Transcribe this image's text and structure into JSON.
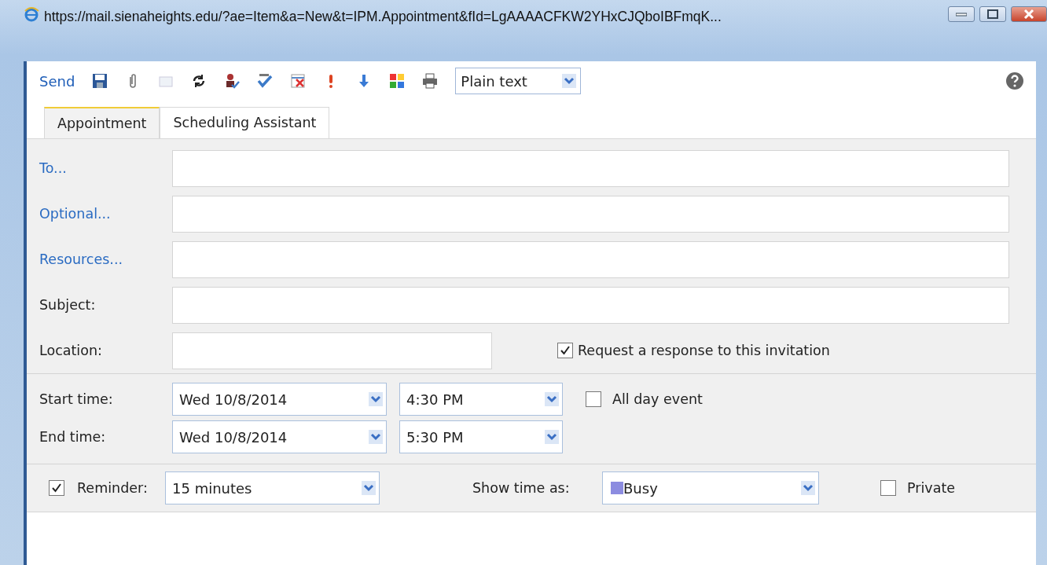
{
  "window": {
    "title": "https://mail.sienaheights.edu/?ae=Item&a=New&t=IPM.Appointment&fId=LgAAAACFKW2YHxCJQboIBFmqK..."
  },
  "toolbar": {
    "send": "Send",
    "format": "Plain text"
  },
  "tabs": [
    {
      "label": "Appointment",
      "selected": true
    },
    {
      "label": "Scheduling Assistant",
      "selected": false
    }
  ],
  "fields": [
    {
      "label": "To...",
      "kind": "link"
    },
    {
      "label": "Optional...",
      "kind": "link"
    },
    {
      "label": "Resources...",
      "kind": "link"
    },
    {
      "label": "Subject:",
      "kind": "plain"
    }
  ],
  "location": {
    "label": "Location:"
  },
  "request_response": {
    "label": "Request a response to this invitation",
    "checked": true
  },
  "times": [
    {
      "label": "Start time:",
      "date": "Wed 10/8/2014",
      "time": "4:30 PM"
    },
    {
      "label": "End time:",
      "date": "Wed 10/8/2014",
      "time": "5:30 PM"
    }
  ],
  "all_day": {
    "label": "All day event",
    "checked": false
  },
  "reminder": {
    "label": "Reminder:",
    "checked": true,
    "value": "15 minutes"
  },
  "show_time_as": {
    "label": "Show time as:",
    "value": "Busy"
  },
  "private": {
    "label": "Private",
    "checked": false
  }
}
